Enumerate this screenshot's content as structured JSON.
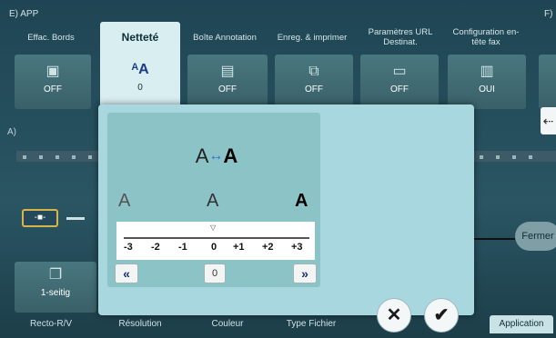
{
  "header": {
    "title": "E) APP",
    "right_label": "F)"
  },
  "tabs": [
    {
      "label": "Effac. Bords"
    },
    {
      "label": "Netteté"
    },
    {
      "label": "Boîte Annotation"
    },
    {
      "label": "Enreg. & imprimer"
    },
    {
      "label": "Paramètres URL Destinat."
    },
    {
      "label": "Configuration en-tête fax"
    }
  ],
  "tiles": [
    {
      "icon": "erase-icon",
      "value": "OFF"
    },
    {
      "icon": "sharpness-icon",
      "value": "0"
    },
    {
      "icon": "stamp-icon",
      "value": "OFF"
    },
    {
      "icon": "save-print-icon",
      "value": "OFF"
    },
    {
      "icon": "url-icon",
      "value": "OFF"
    },
    {
      "icon": "fax-header-icon",
      "value": "OUI"
    }
  ],
  "section_a": "A)",
  "dialog": {
    "preview_left": "A",
    "preview_arrow": "↔",
    "preview_right": "A",
    "letters": [
      "A",
      "A",
      "A"
    ],
    "scale_labels": [
      "-3",
      "-2",
      "-1",
      "0",
      "+1",
      "+2",
      "+3"
    ],
    "current_value": "0",
    "left_button": "«",
    "right_button": "»",
    "cancel": "✕",
    "ok": "✔"
  },
  "left_panel": {
    "duplex_label": "1-seitig"
  },
  "right_button": "Fermer",
  "bottom_tabs": [
    "Recto-R/V",
    "Résolution",
    "Couleur",
    "Type Fichier",
    "Application"
  ]
}
